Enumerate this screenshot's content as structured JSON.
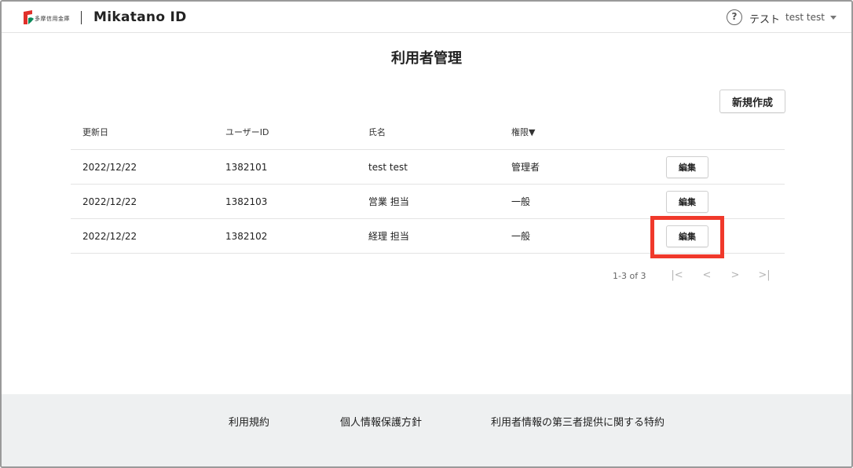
{
  "header": {
    "bank_name": "多摩信用金庫",
    "app_name": "Mikatano ID",
    "user_org": "テスト",
    "user_name": "test test",
    "accent": "#e0302a",
    "logo_green": "#0b8a5a"
  },
  "main": {
    "title": "利用者管理",
    "new_button": "新規作成",
    "table": {
      "headers": [
        "更新日",
        "ユーザーID",
        "氏名",
        "権限▼"
      ],
      "edit_label": "編集",
      "rows": [
        {
          "date": "2022/12/22",
          "user_id": "1382101",
          "name": "test test",
          "role": "管理者"
        },
        {
          "date": "2022/12/22",
          "user_id": "1382103",
          "name": "営業 担当",
          "role": "一般"
        },
        {
          "date": "2022/12/22",
          "user_id": "1382102",
          "name": "経理 担当",
          "role": "一般"
        }
      ]
    },
    "pagination": {
      "info": "1-3 of 3",
      "first": "|<",
      "prev": "<",
      "next": ">",
      "last": ">|"
    },
    "highlight_color": "#f0392b"
  },
  "footer": {
    "links": [
      "利用規約",
      "個人情報保護方針",
      "利用者情報の第三者提供に関する特約"
    ]
  },
  "icons": {
    "help": "question-circle-icon",
    "caret": "caret-down-icon"
  }
}
